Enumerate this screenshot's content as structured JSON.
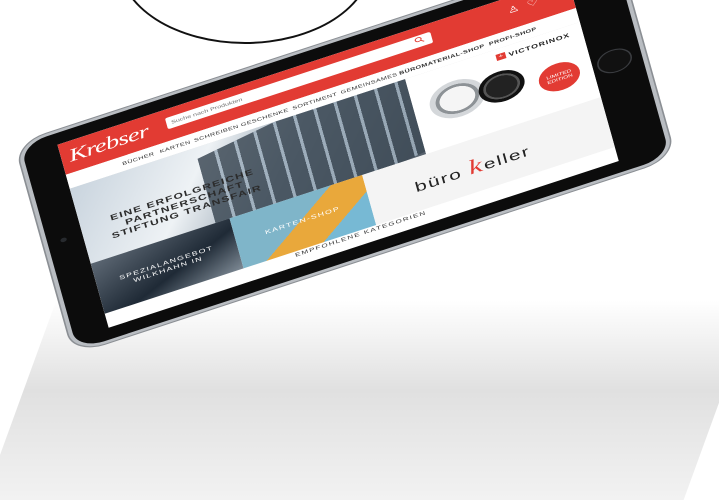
{
  "header": {
    "logo": "Krebser",
    "search_placeholder": "Suche nach Produkten"
  },
  "nav": {
    "items": [
      "BÜCHER",
      "KARTEN",
      "SCHREIBEN",
      "GESCHENKE",
      "SORTIMENT",
      "GEMEINSAMES"
    ],
    "featured": [
      "BÜROMATERIAL-SHOP",
      "PROFI-SHOP"
    ]
  },
  "hero": {
    "text": "EINE ERFOLGREICHE PARTNERSCHAFT STIFTUNG TRANSFAIR"
  },
  "watch_promo": {
    "brand": "VICTORINOX",
    "badge": "LIMITED EDITION"
  },
  "tiles": {
    "special": "SPEZIALANGEBOT WILKHAHN IN",
    "karten": "KARTEN-SHOP",
    "buero_prefix": "büro ",
    "buero_k": "k",
    "buero_suffix": "eller"
  },
  "section_title": "EMPFOHLENE KATEGORIEN",
  "colors": {
    "brand_red": "#e23b33",
    "device_black": "#0c0c0c"
  },
  "icons": [
    "search-icon",
    "user-icon",
    "heart-icon",
    "cart-icon",
    "cross-icon"
  ]
}
